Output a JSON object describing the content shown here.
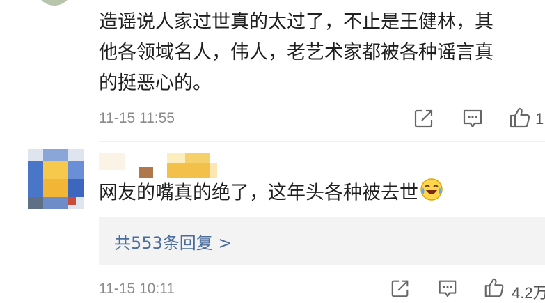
{
  "comments": [
    {
      "lines": [
        "造谣说人家过世真的太过了，不止是王健林，其",
        "他各领域名人，伟人，老艺术家都被各种谣言真",
        "的挺恶心的。"
      ],
      "timestamp": "11-15 11:55",
      "like_count": "1"
    },
    {
      "text": "网友的嘴真的绝了，这年头各种被去世",
      "emoji": "laughing-crying-emoji",
      "replies_link": "共553条回复 >",
      "timestamp": "11-15 10:11",
      "like_count": "4.2万"
    }
  ],
  "icons": {
    "share": "share-icon",
    "comment": "comment-icon",
    "like": "thumbs-up-icon"
  },
  "colors": {
    "text": "#1f1f1f",
    "meta": "#8a8a8a",
    "link": "#4a6d9c",
    "reply_bg": "#f3f3f4",
    "icon": "#666666"
  }
}
